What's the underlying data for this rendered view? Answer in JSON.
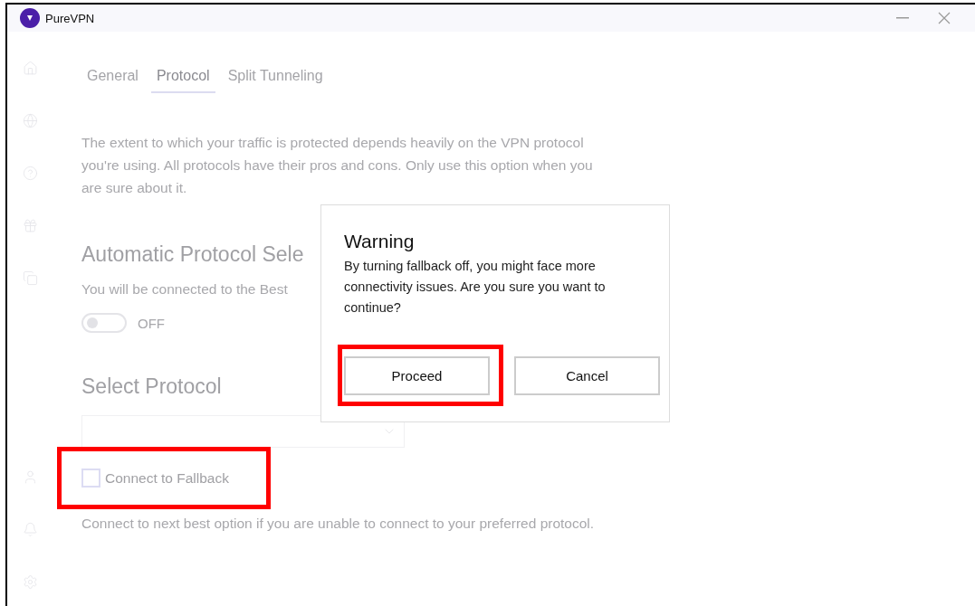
{
  "window": {
    "title": "PureVPN"
  },
  "tabs": [
    {
      "label": "General",
      "selected": false
    },
    {
      "label": "Protocol",
      "selected": true
    },
    {
      "label": "Split Tunneling",
      "selected": false
    }
  ],
  "description": "The extent to which your traffic is protected depends heavily on the VPN protocol you're using. All protocols have their pros and cons. Only use this option when you are sure about it.",
  "automatic_protocol": {
    "heading": "Automatic Protocol Sele",
    "subtitle": "You will be connected to the Best",
    "toggle": {
      "on": false,
      "label": "OFF"
    }
  },
  "select_protocol": {
    "heading": "Select Protocol"
  },
  "fallback": {
    "label": "Connect to Fallback",
    "checked": false,
    "description": "Connect to next best option if you are unable to connect to your preferred protocol."
  },
  "dialog": {
    "title": "Warning",
    "message": "By turning fallback off, you might face more connectivity issues. Are you sure you want to continue?",
    "buttons": [
      {
        "label": "Proceed",
        "highlighted": true
      },
      {
        "label": "Cancel",
        "highlighted": false
      }
    ]
  }
}
